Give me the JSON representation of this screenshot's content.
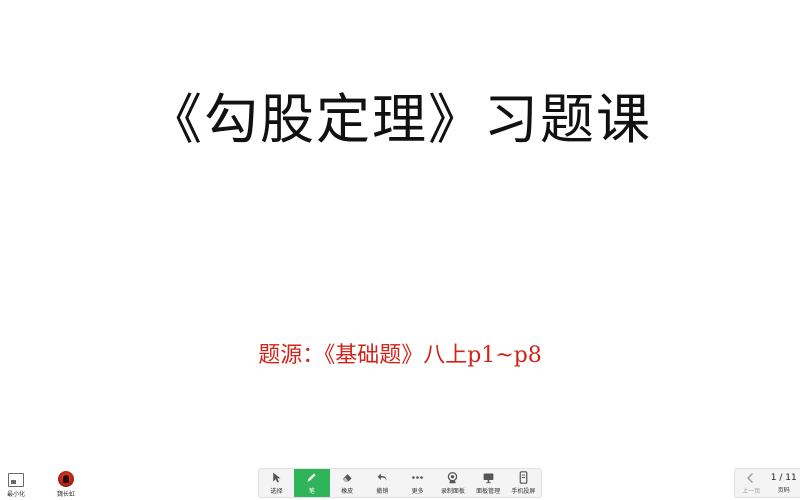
{
  "slide": {
    "title": "《勾股定理》习题课",
    "subtitle": "题源：《基础题》八上p1~p8"
  },
  "left_cluster": {
    "items": [
      {
        "label": "最小化",
        "icon": "minimize-window-icon"
      },
      {
        "label": "魏长虹",
        "icon": "avatar"
      }
    ]
  },
  "toolbar": {
    "items": [
      {
        "label": "选择",
        "icon": "cursor-icon"
      },
      {
        "label": "笔",
        "icon": "pen-icon",
        "active": true
      },
      {
        "label": "橡皮",
        "icon": "eraser-icon"
      },
      {
        "label": "撤销",
        "icon": "undo-icon"
      },
      {
        "label": "更多",
        "icon": "more-icon"
      },
      {
        "label": "录制面板",
        "icon": "record-icon"
      },
      {
        "label": "面板管理",
        "icon": "panel-icon"
      },
      {
        "label": "手机投屏",
        "icon": "phone-icon"
      }
    ]
  },
  "pager": {
    "prev_label": "上一页",
    "page_text": "1 / 11",
    "page_label": "页码"
  },
  "colors": {
    "title": "#111111",
    "subtitle": "#d0241a",
    "active_tool": "#2fb45a"
  }
}
